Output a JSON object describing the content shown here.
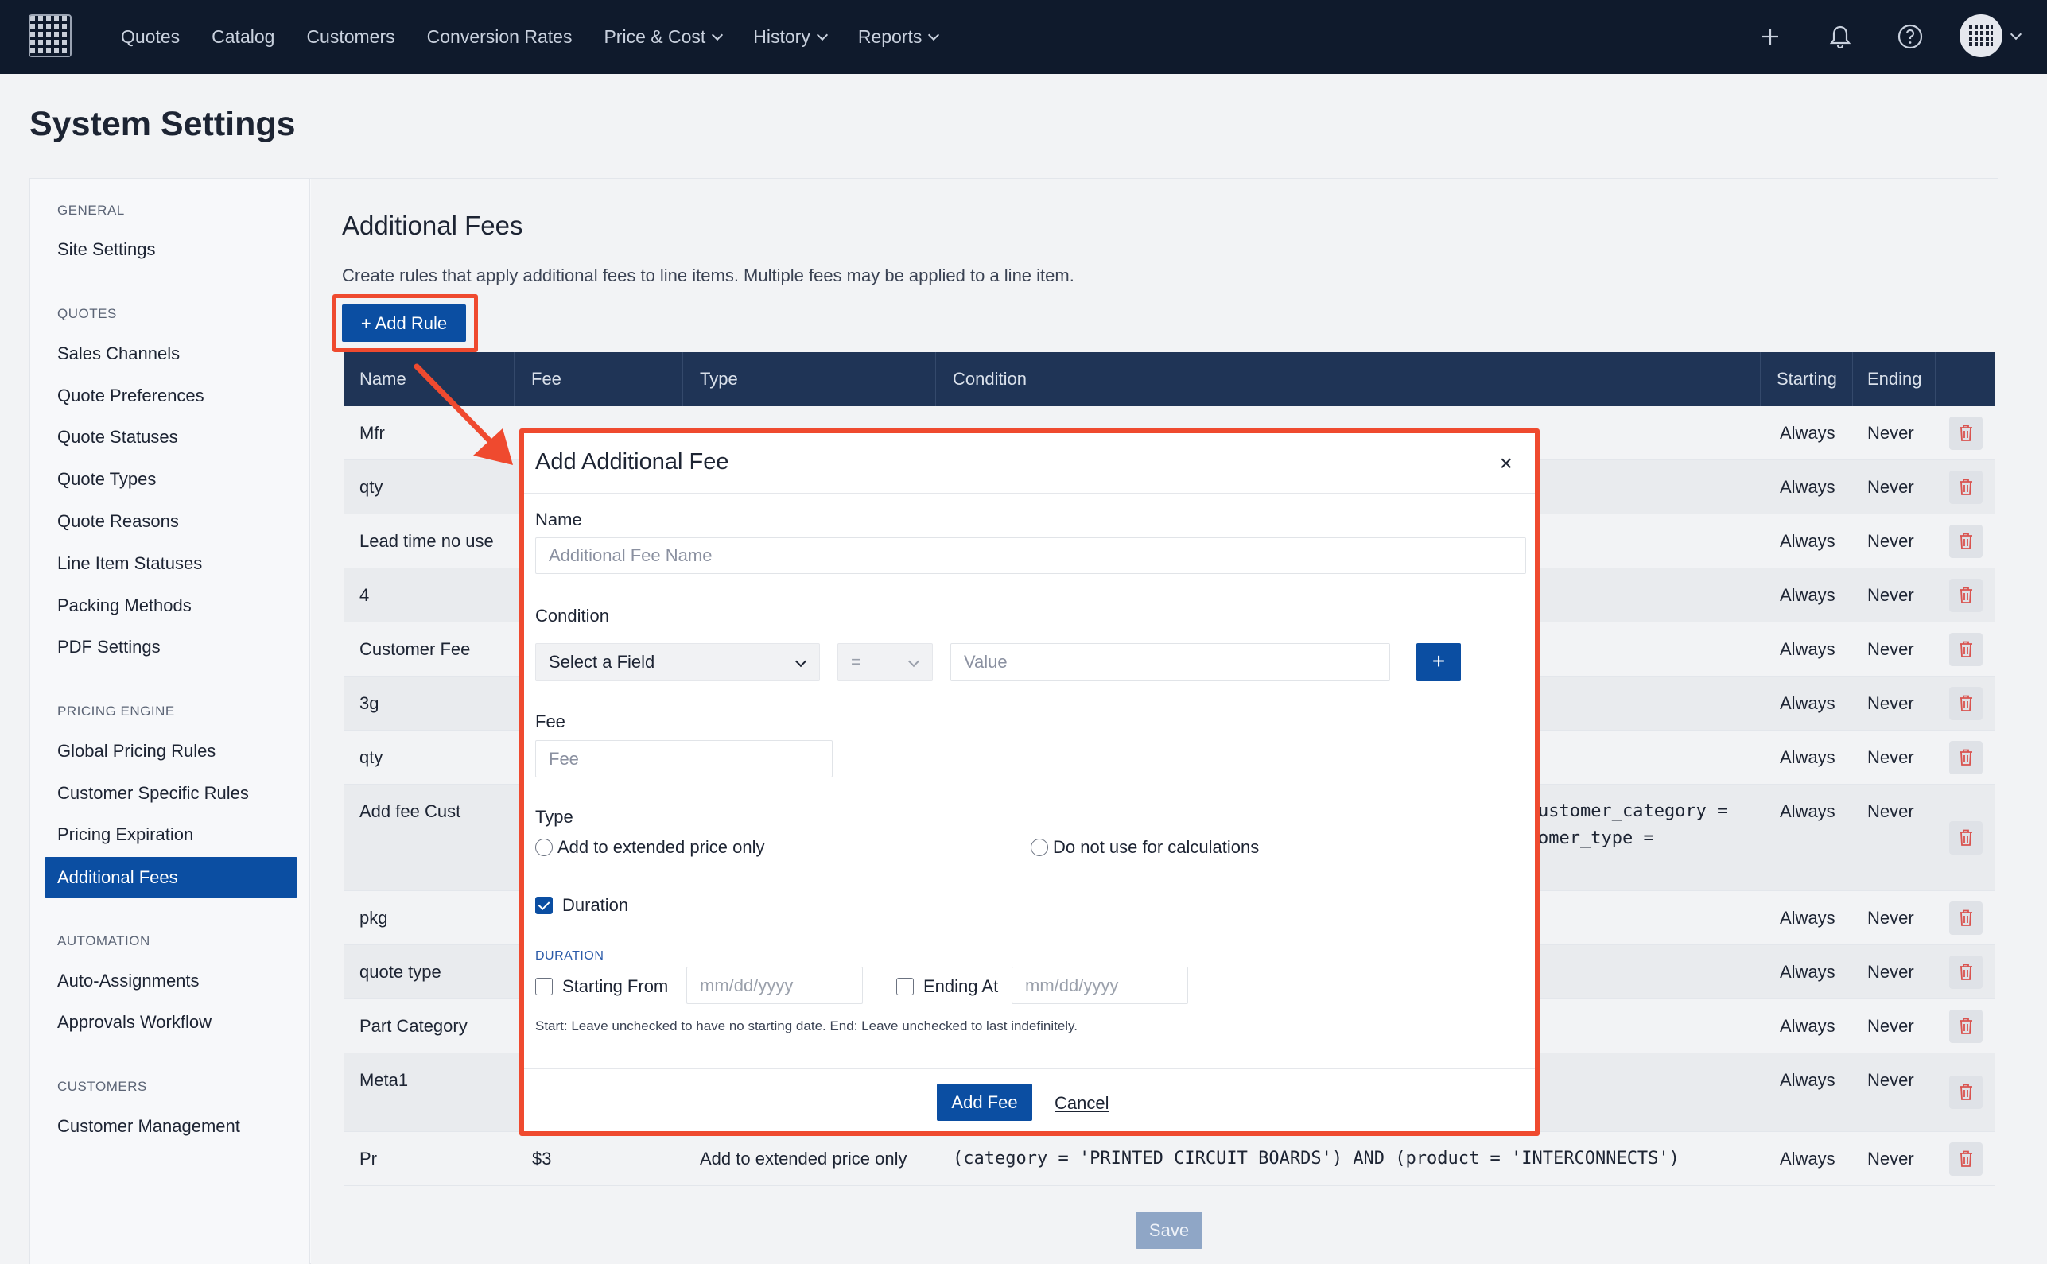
{
  "nav": {
    "links": [
      {
        "label": "Quotes",
        "dropdown": false
      },
      {
        "label": "Catalog",
        "dropdown": false
      },
      {
        "label": "Customers",
        "dropdown": false
      },
      {
        "label": "Conversion Rates",
        "dropdown": false
      },
      {
        "label": "Price & Cost",
        "dropdown": true
      },
      {
        "label": "History",
        "dropdown": true
      },
      {
        "label": "Reports",
        "dropdown": true
      }
    ],
    "icons": [
      "plus-icon",
      "bell-icon",
      "help-icon",
      "avatar"
    ]
  },
  "page": {
    "title": "System Settings"
  },
  "sidebar": {
    "groups": [
      {
        "title": "GENERAL",
        "items": [
          "Site Settings"
        ]
      },
      {
        "title": "QUOTES",
        "items": [
          "Sales Channels",
          "Quote Preferences",
          "Quote Statuses",
          "Quote Types",
          "Quote Reasons",
          "Line Item Statuses",
          "Packing Methods",
          "PDF Settings"
        ]
      },
      {
        "title": "PRICING ENGINE",
        "items": [
          "Global Pricing Rules",
          "Customer Specific Rules",
          "Pricing Expiration",
          "Additional Fees"
        ]
      },
      {
        "title": "AUTOMATION",
        "items": [
          "Auto-Assignments",
          "Approvals Workflow"
        ]
      },
      {
        "title": "CUSTOMERS",
        "items": [
          "Customer Management"
        ]
      }
    ],
    "active": "Additional Fees"
  },
  "section": {
    "title": "Additional Fees",
    "description": "Create rules that apply additional fees to line items. Multiple fees may be applied to a line item.",
    "add_rule_label": "+ Add Rule",
    "save_label": "Save"
  },
  "table": {
    "headers": [
      "Name",
      "Fee",
      "Type",
      "Condition",
      "Starting",
      "Ending"
    ],
    "rows": [
      {
        "name": "Mfr",
        "fee": "",
        "type": "",
        "condition": "",
        "starting": "Always",
        "ending": "Never"
      },
      {
        "name": "qty",
        "fee": "",
        "type": "",
        "condition": "",
        "starting": "Always",
        "ending": "Never"
      },
      {
        "name": "Lead time no use",
        "fee": "",
        "type": "",
        "condition": "",
        "starting": "Always",
        "ending": "Never"
      },
      {
        "name": "4",
        "fee": "",
        "type": "",
        "condition": "",
        "starting": "Always",
        "ending": "Never"
      },
      {
        "name": "Customer Fee",
        "fee": "",
        "type": "",
        "condition": "",
        "starting": "Always",
        "ending": "Never"
      },
      {
        "name": "3g",
        "fee": "",
        "type": "",
        "condition": "",
        "starting": "Always",
        "ending": "Never"
      },
      {
        "name": "qty",
        "fee": "",
        "type": "",
        "condition": "",
        "starting": "Always",
        "ending": "Never"
      },
      {
        "name": "Add fee Cust",
        "fee": "",
        "type": "",
        "condition": "ustomer_category =",
        "condition2": "omer_type =",
        "starting": "Always",
        "ending": "Never"
      },
      {
        "name": "pkg",
        "fee": "",
        "type": "",
        "condition": "",
        "starting": "Always",
        "ending": "Never"
      },
      {
        "name": "quote type",
        "fee": "",
        "type": "",
        "condition": "",
        "starting": "Always",
        "ending": "Never"
      },
      {
        "name": "Part Category",
        "fee": "",
        "type": "",
        "condition": "",
        "starting": "Always",
        "ending": "Never"
      },
      {
        "name": "Meta1",
        "fee": "",
        "type": "",
        "condition": "",
        "starting": "Always",
        "ending": "Never"
      },
      {
        "name": "Pr",
        "fee": "$3",
        "type": "Add to extended price only",
        "condition": "(category = 'PRINTED CIRCUIT BOARDS') AND (product = 'INTERCONNECTS')",
        "starting": "Always",
        "ending": "Never"
      }
    ]
  },
  "modal": {
    "title": "Add Additional Fee",
    "close": "×",
    "name_label": "Name",
    "name_placeholder": "Additional Fee Name",
    "condition_label": "Condition",
    "field_select": "Select a Field",
    "operator_select": "=",
    "value_placeholder": "Value",
    "add_condition": "+",
    "fee_label": "Fee",
    "fee_placeholder": "Fee",
    "type_label": "Type",
    "type_options": [
      "Add to extended price only",
      "Do not use for calculations"
    ],
    "duration_check_label": "Duration",
    "duration_checked": true,
    "duration_group": "DURATION",
    "starting_from_label": "Starting From",
    "ending_at_label": "Ending At",
    "date_placeholder": "mm/dd/yyyy",
    "help_text": "Start: Leave unchecked to have no starting date. End: Leave unchecked to last indefinitely.",
    "submit_label": "Add Fee",
    "cancel_label": "Cancel"
  },
  "colors": {
    "nav_bg": "#0f1a2c",
    "primary": "#0b4ea2",
    "highlight": "#ef4a2f",
    "table_header": "#1f3456",
    "trash": "#d9534f"
  }
}
